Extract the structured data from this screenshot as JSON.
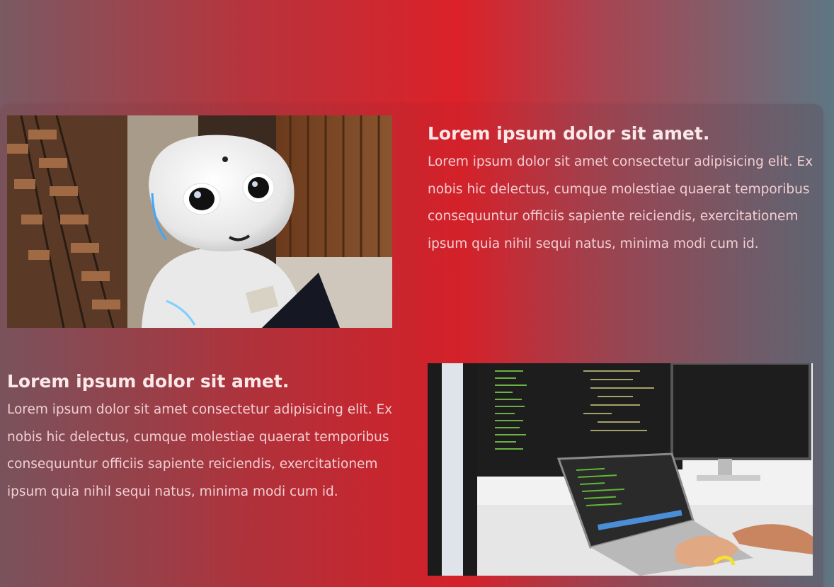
{
  "sections": [
    {
      "heading": "Lorem ipsum dolor sit amet.",
      "body": "Lorem ipsum dolor sit amet consectetur adipisicing elit. Ex nobis hic delectus, cumque molestiae quaerat temporibus consequuntur officiis sapiente reiciendis, exercitationem ipsum quia nihil sequi natus, minima modi cum id.",
      "image_icon": "robot-photo"
    },
    {
      "heading": "Lorem ipsum dolor sit amet.",
      "body": "Lorem ipsum dolor sit amet consectetur adipisicing elit. Ex nobis hic delectus, cumque molestiae quaerat temporibus consequuntur officiis sapiente reiciendis, exercitationem ipsum quia nihil sequi natus, minima modi cum id.",
      "image_icon": "laptop-code-photo"
    }
  ],
  "colors": {
    "accent": "#dc2129",
    "heading": "#fbe9ea",
    "body_text": "#f2cfd3"
  }
}
